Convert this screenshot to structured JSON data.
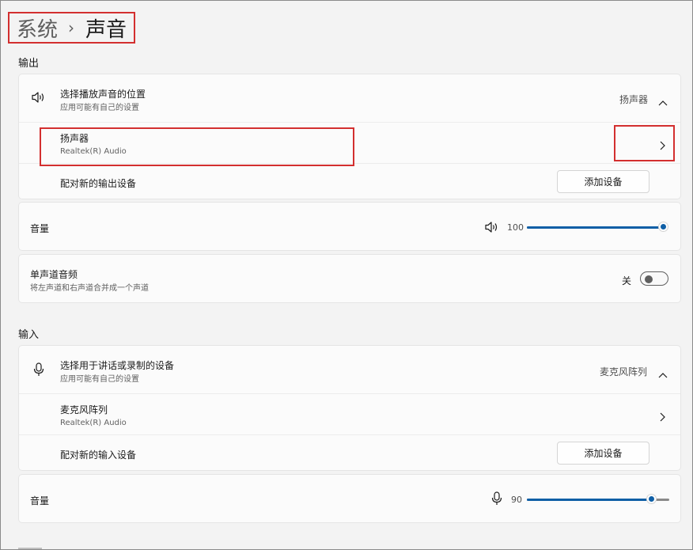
{
  "breadcrumb": {
    "parent": "系统",
    "separator": "›",
    "current": "声音"
  },
  "output": {
    "section_label": "输出",
    "choose_device": {
      "icon": "speaker-icon",
      "title": "选择播放声音的位置",
      "subtitle": "应用可能有自己的设置",
      "value": "扬声器",
      "expand_icon": "chevron-up-icon"
    },
    "device": {
      "name": "扬声器",
      "driver": "Realtek(R) Audio",
      "chevron_icon": "chevron-right-icon"
    },
    "pair": {
      "label": "配对新的输出设备",
      "button": "添加设备"
    },
    "volume": {
      "label": "音量",
      "icon": "speaker-icon",
      "value": "100",
      "level": 1.0
    },
    "mono": {
      "title": "单声道音频",
      "subtitle": "将左声道和右声道合并成一个声道",
      "state": "关"
    }
  },
  "input": {
    "section_label": "输入",
    "choose_device": {
      "icon": "microphone-icon",
      "title": "选择用于讲话或录制的设备",
      "subtitle": "应用可能有自己的设置",
      "value": "麦克风阵列",
      "expand_icon": "chevron-up-icon"
    },
    "device": {
      "name": "麦克风阵列",
      "driver": "Realtek(R) Audio",
      "chevron_icon": "chevron-right-icon"
    },
    "pair": {
      "label": "配对新的输入设备",
      "button": "添加设备"
    },
    "volume": {
      "label": "音量",
      "icon": "microphone-icon",
      "value": "90",
      "level": 0.9
    }
  },
  "colors": {
    "accent": "#0f5fa6",
    "highlight_box": "#d32f2f"
  }
}
